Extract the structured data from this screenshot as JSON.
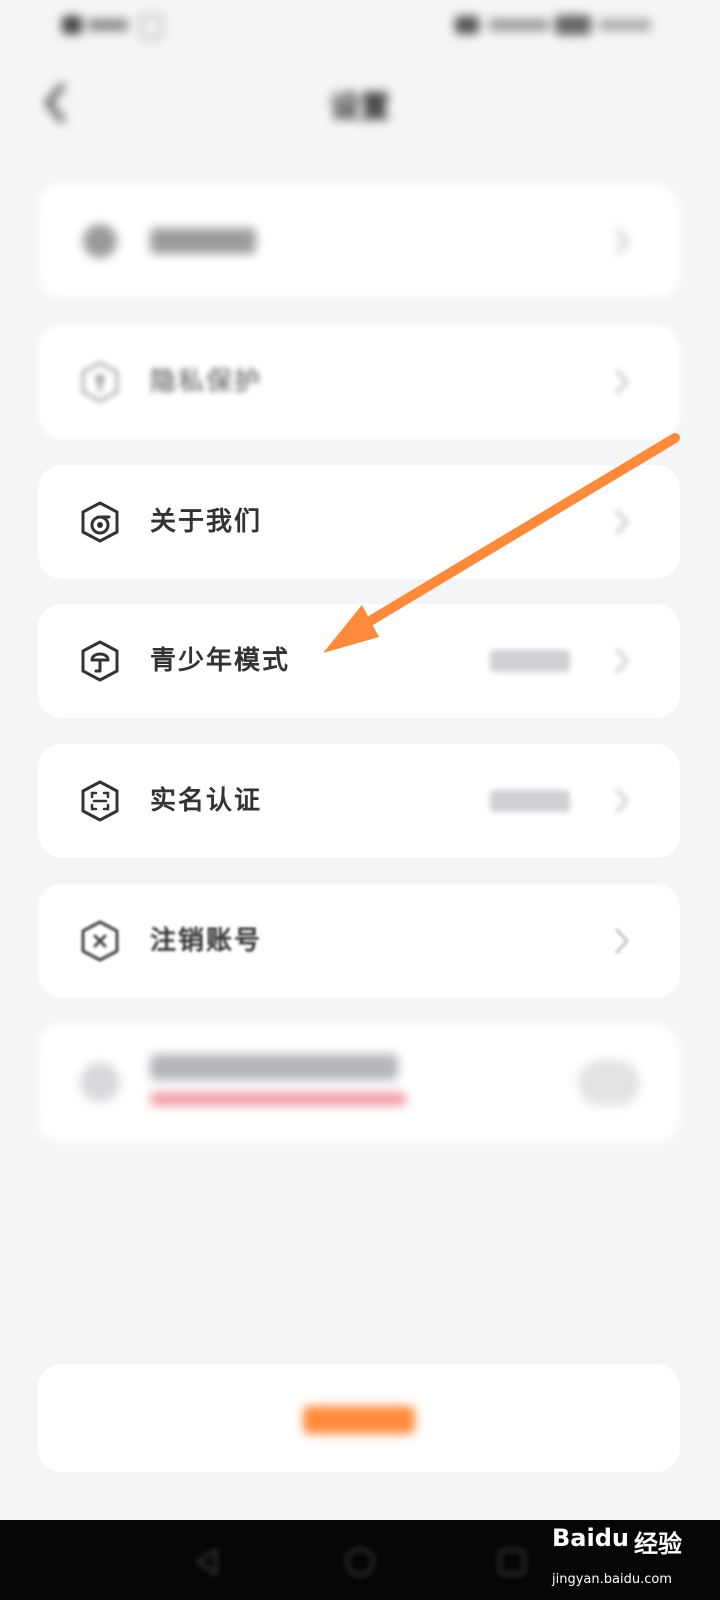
{
  "header": {
    "title": "设置"
  },
  "settings": [
    {
      "label": "",
      "icon": "account-icon"
    },
    {
      "label": "隐私保护",
      "icon": "privacy-shield-icon"
    },
    {
      "label": "关于我们",
      "icon": "about-icon"
    },
    {
      "label": "青少年模式",
      "icon": "teen-mode-icon"
    },
    {
      "label": "实名认证",
      "icon": "real-name-scan-icon"
    },
    {
      "label": "注销账号",
      "icon": "close-icon"
    }
  ],
  "annotation": {
    "color": "#ff8a3c"
  },
  "colors": {
    "accent": "#ff7a30",
    "background": "#f4f5f7",
    "card": "#ffffff"
  },
  "logout": {
    "label": ""
  },
  "watermark": {
    "brand": "Baidu",
    "suffix": "经验",
    "url": "jingyan.baidu.com"
  }
}
